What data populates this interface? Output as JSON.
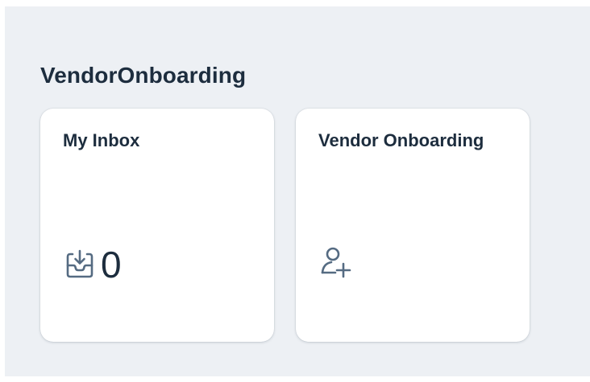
{
  "group": {
    "title": "VendorOnboarding"
  },
  "tiles": [
    {
      "title": "My Inbox",
      "icon": "inbox-download-icon",
      "count": "0"
    },
    {
      "title": "Vendor Onboarding",
      "icon": "add-person-icon"
    }
  ],
  "colors": {
    "background": "#edf0f4",
    "tile": "#ffffff",
    "text": "#1d2d3e",
    "icon": "#556b82"
  }
}
